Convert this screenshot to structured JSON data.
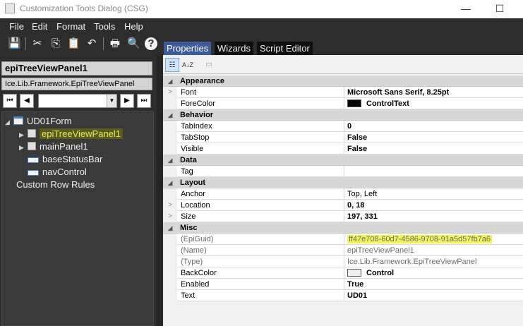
{
  "window": {
    "title": "Customization Tools Dialog  (CSG)",
    "minimize_glyph": "—",
    "maximize_glyph": "☐"
  },
  "menu": [
    "File",
    "Edit",
    "Format",
    "Tools",
    "Help"
  ],
  "toolbar": {
    "icons": [
      "save-icon",
      "cut-icon",
      "copy-icon",
      "paste-icon",
      "undo-icon",
      "print-icon",
      "print-preview-icon",
      "help-icon"
    ],
    "glyphs": [
      "💾",
      "✂",
      "⎘",
      "📋",
      "↶",
      "🖶",
      "🔍",
      "?"
    ]
  },
  "left": {
    "control_name": "epiTreeViewPanel1",
    "control_type": "Ice.Lib.Framework.EpiTreeViewPanel",
    "nav": {
      "first": "⏮",
      "prev": "◀",
      "next": "▶",
      "last": "⏭",
      "combo_value": "",
      "arrow": "▼"
    },
    "tree": [
      {
        "label": "UD01Form",
        "expander": "◢"
      },
      {
        "label": "epiTreeViewPanel1",
        "expander": "▶"
      },
      {
        "label": "mainPanel1",
        "expander": "▶"
      },
      {
        "label": "baseStatusBar",
        "expander": ""
      },
      {
        "label": "navControl",
        "expander": ""
      },
      {
        "label": "Custom Row Rules",
        "expander": ""
      }
    ]
  },
  "tabs": [
    "Properties",
    "Wizards",
    "Script Editor"
  ],
  "grid": {
    "toolbar": {
      "categorized_glyph": "☷",
      "alpha_glyph": "A↓Z",
      "pages_glyph": "▭"
    },
    "categories": [
      {
        "name": "Appearance",
        "rows": [
          {
            "name": "Font",
            "value": "Microsoft Sans Serif, 8.25pt",
            "bold": true,
            "expander": ">"
          },
          {
            "name": "ForeColor",
            "value": "ControlText",
            "bold": true,
            "swatch": "#000000"
          }
        ]
      },
      {
        "name": "Behavior",
        "rows": [
          {
            "name": "TabIndex",
            "value": "0",
            "bold": true
          },
          {
            "name": "TabStop",
            "value": "False",
            "bold": true
          },
          {
            "name": "Visible",
            "value": "False",
            "bold": true
          }
        ]
      },
      {
        "name": "Data",
        "rows": [
          {
            "name": "Tag",
            "value": "",
            "bold": false
          }
        ]
      },
      {
        "name": "Layout",
        "rows": [
          {
            "name": "Anchor",
            "value": "Top, Left",
            "bold": false
          },
          {
            "name": "Location",
            "value": "0, 18",
            "bold": true,
            "expander": ">"
          },
          {
            "name": "Size",
            "value": "197, 331",
            "bold": true,
            "expander": ">"
          }
        ]
      },
      {
        "name": "Misc",
        "rows": [
          {
            "name": "(EpiGuid)",
            "value": "ff47e708-60d7-4586-9708-91a5d57fb7a6",
            "bold": false,
            "dim": true,
            "highlight": true
          },
          {
            "name": "(Name)",
            "value": "epiTreeViewPanel1",
            "bold": false,
            "dim": true
          },
          {
            "name": "(Type)",
            "value": "Ice.Lib.Framework.EpiTreeViewPanel",
            "bold": false,
            "dim": true
          },
          {
            "name": "BackColor",
            "value": "Control",
            "bold": true,
            "swatch": "#f0f0f0"
          },
          {
            "name": "Enabled",
            "value": "True",
            "bold": true
          },
          {
            "name": "Text",
            "value": "UD01",
            "bold": true
          }
        ]
      }
    ],
    "collapse_glyph": "◢"
  }
}
